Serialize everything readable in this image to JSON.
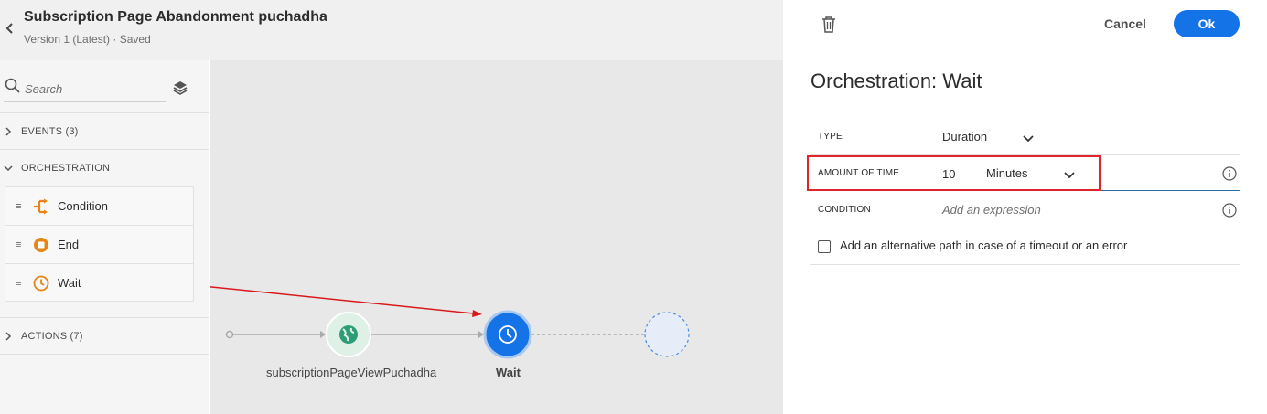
{
  "header": {
    "title": "Subscription Page Abandonment puchadha",
    "version": "Version 1 (Latest) · Saved"
  },
  "sidebar": {
    "search_placeholder": "Search",
    "sections": {
      "events": "EVENTS (3)",
      "orchestration": "ORCHESTRATION",
      "actions": "ACTIONS (7)"
    },
    "orchestration_items": [
      {
        "label": "Condition",
        "icon": "condition-icon"
      },
      {
        "label": "End",
        "icon": "end-icon"
      },
      {
        "label": "Wait",
        "icon": "clock-icon"
      }
    ]
  },
  "canvas": {
    "nodes": [
      {
        "label": "subscriptionPageViewPuchadha",
        "icon": "globe-icon"
      },
      {
        "label": "Wait",
        "icon": "clock-icon",
        "selected": true
      },
      {
        "label": "",
        "icon": "empty-placeholder"
      }
    ]
  },
  "panel": {
    "cancel_label": "Cancel",
    "ok_label": "Ok",
    "title": "Orchestration: Wait",
    "type_label": "TYPE",
    "type_value": "Duration",
    "amount_label": "AMOUNT OF TIME",
    "amount_value": "10",
    "amount_unit": "Minutes",
    "condition_label": "CONDITION",
    "condition_placeholder": "Add an expression",
    "alt_path_label": "Add an alternative path in case of a timeout or an error"
  },
  "colors": {
    "accent": "#1473e6",
    "orchestration_icon": "#e68619",
    "highlight": "#e0252a",
    "arrow": "#d7191c"
  }
}
